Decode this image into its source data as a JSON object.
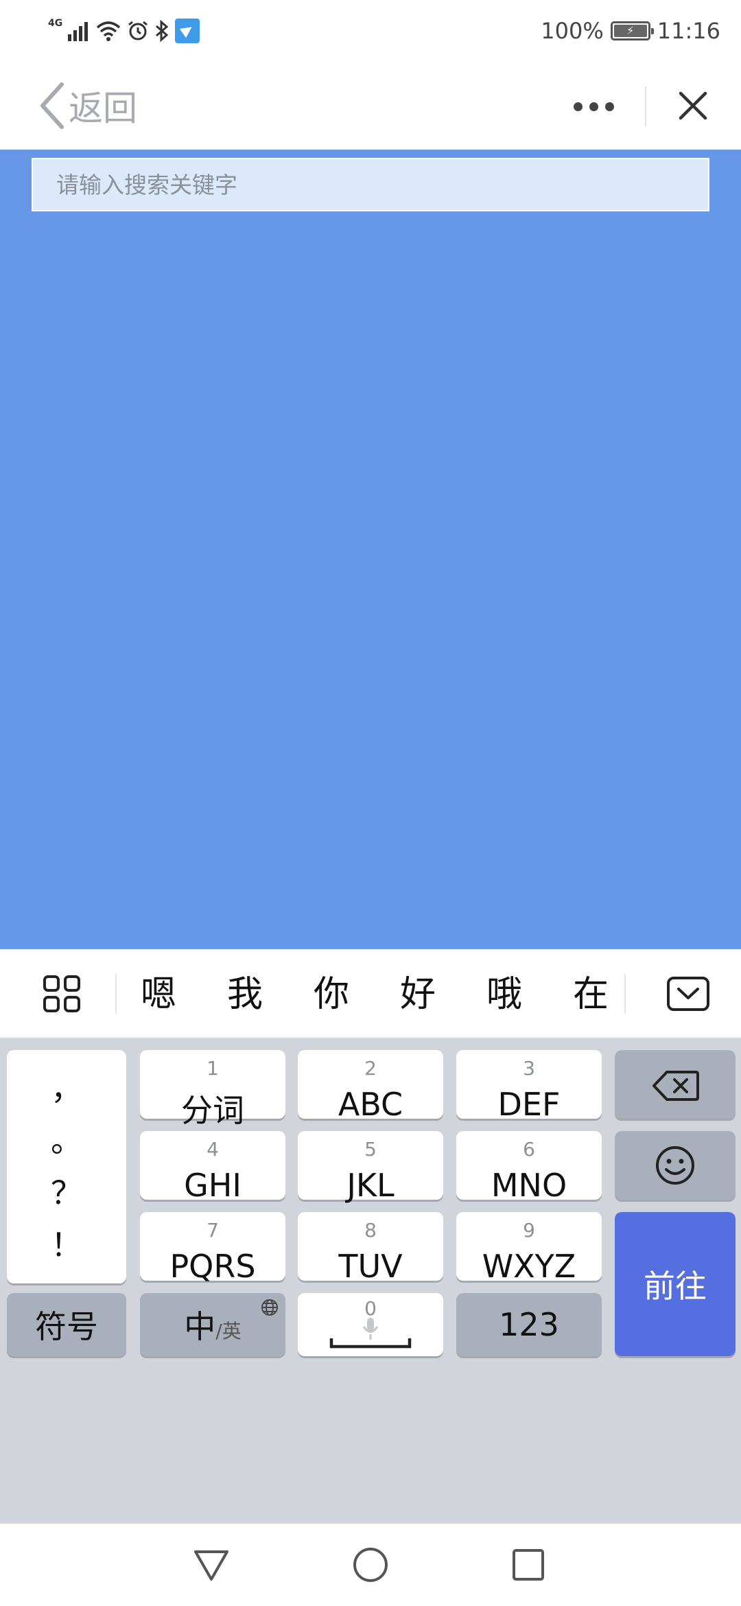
{
  "status_bar": {
    "network_label": "4G",
    "battery_text": "100%",
    "battery_level": 1.0,
    "time": "11:16"
  },
  "nav": {
    "back_label": "返回"
  },
  "search": {
    "placeholder": "请输入搜索关键字",
    "value": ""
  },
  "content": {
    "background_color": "#6797e9"
  },
  "candidates": [
    "嗯",
    "我",
    "你",
    "好",
    "哦",
    "在"
  ],
  "keyboard": {
    "punctuation": [
      "，",
      "。",
      "？",
      "！"
    ],
    "keys": [
      {
        "num": "1",
        "label": "分词"
      },
      {
        "num": "2",
        "label": "ABC"
      },
      {
        "num": "3",
        "label": "DEF"
      },
      {
        "num": "4",
        "label": "GHI"
      },
      {
        "num": "5",
        "label": "JKL"
      },
      {
        "num": "6",
        "label": "MNO"
      },
      {
        "num": "7",
        "label": "PQRS"
      },
      {
        "num": "8",
        "label": "TUV"
      },
      {
        "num": "9",
        "label": "WXYZ"
      }
    ],
    "symbol_label": "符号",
    "lang_main": "中",
    "lang_sub": "/英",
    "space_num": "0",
    "numeric_label": "123",
    "go_label": "前往",
    "accent_color": "#566fe0"
  }
}
